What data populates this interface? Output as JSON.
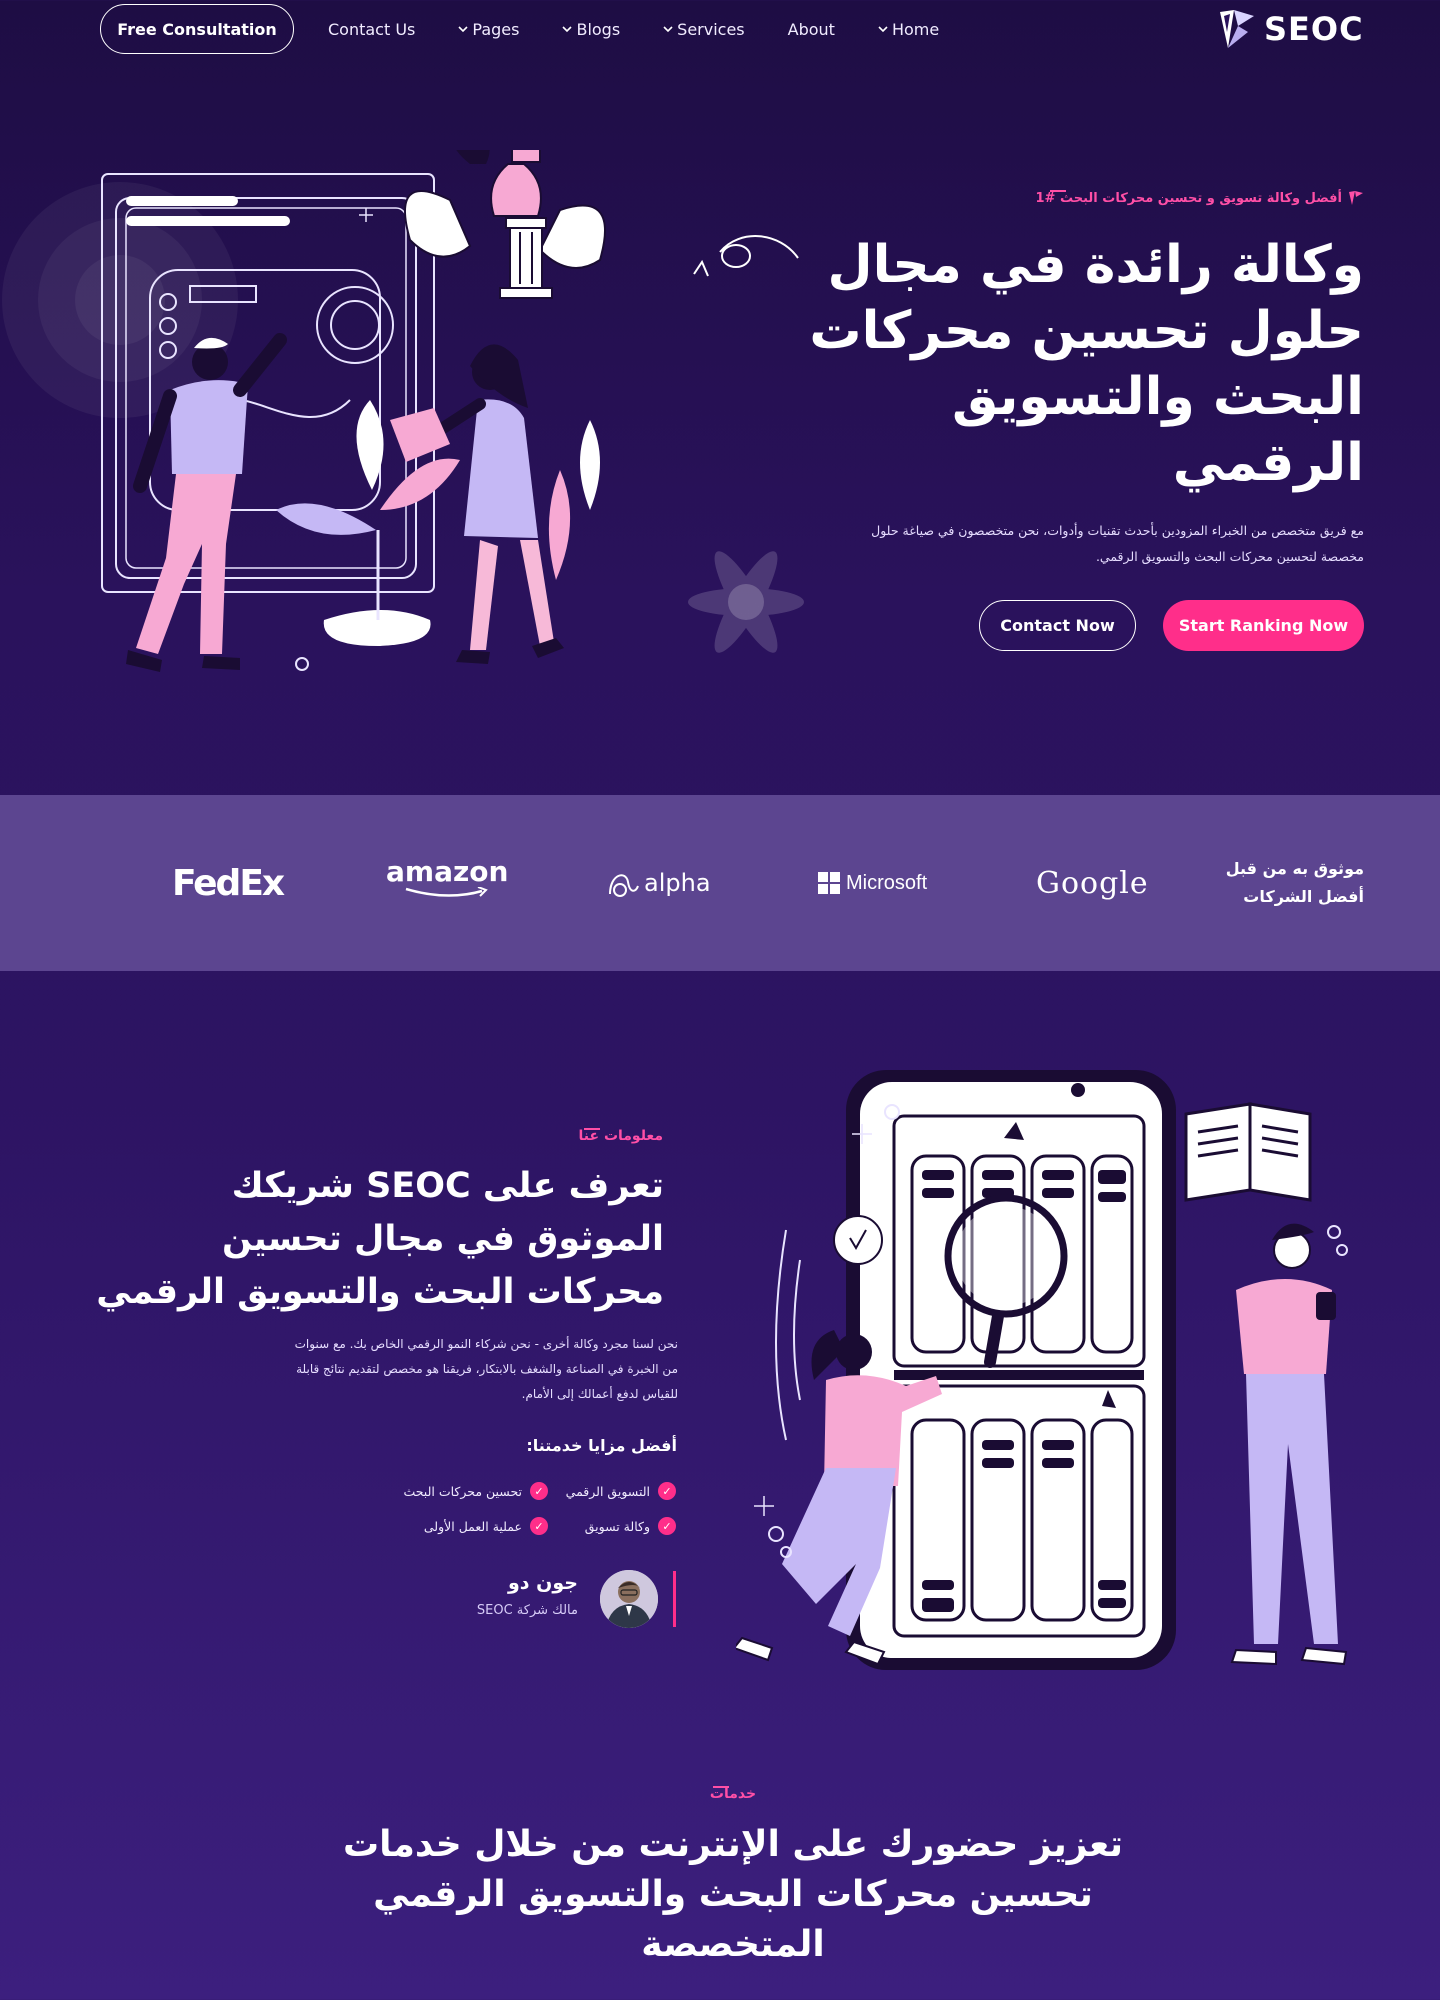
{
  "nav": {
    "consult_label": "Free Consultation",
    "links": [
      "Contact Us",
      "Pages",
      "Blogs",
      "Services",
      "About",
      "Home"
    ],
    "logo_text": "SEOC"
  },
  "hero": {
    "tag": "أفضل وكالة تسويق و تحسين محركات البحث #1",
    "title": "وكالة رائدة في مجال حلول تحسين محركات البحث والتسويق الرقمي",
    "description": "مع فريق متخصص من الخبراء المزودين بأحدث تقنيات وأدوات، نحن متخصصون في صياغة حلول مخصصة لتحسين محركات البحث والتسويق الرقمي.",
    "ranking_button": "Start Ranking Now",
    "contact_button": "Contact Now"
  },
  "partners": {
    "label": "موثوق به من قبل أفضل الشركات",
    "logos": [
      "Google",
      "Microsoft",
      "alpha",
      "amazon",
      "FedEx"
    ]
  },
  "about": {
    "tag": "معلومات عنا",
    "title": "تعرف على SEOC شريكك الموثوق في مجال تحسين محركات البحث والتسويق الرقمي",
    "description": "نحن لسنا مجرد وكالة أخرى - نحن شركاء النمو الرقمي الخاص بك. مع سنوات من الخبرة في الصناعة والشغف بالابتكار، فريقنا هو مخصص لتقديم نتائج قابلة للقياس لدفع أعمالك إلى الأمام.",
    "features_title": "أفضل مزايا خدمتنا:",
    "features": [
      "التسويق الرقمي",
      "تحسين محركات البحث",
      "وكالة تسويق",
      "عملية العمل الأولى"
    ],
    "author_name": "جون دو",
    "author_role": "مالك شركة SEOC"
  },
  "services": {
    "tag": "خدمات",
    "title": "تعزيز حضورك على الإنترنت من خلال خدمات تحسين محركات البحث والتسويق الرقمي المتخصصة"
  },
  "colors": {
    "background": "#2a125c",
    "accent": "#ff2e8a",
    "band": "#5c4590",
    "illustration_pink": "#f7a9d3",
    "illustration_lavender": "#c5b8f5"
  }
}
